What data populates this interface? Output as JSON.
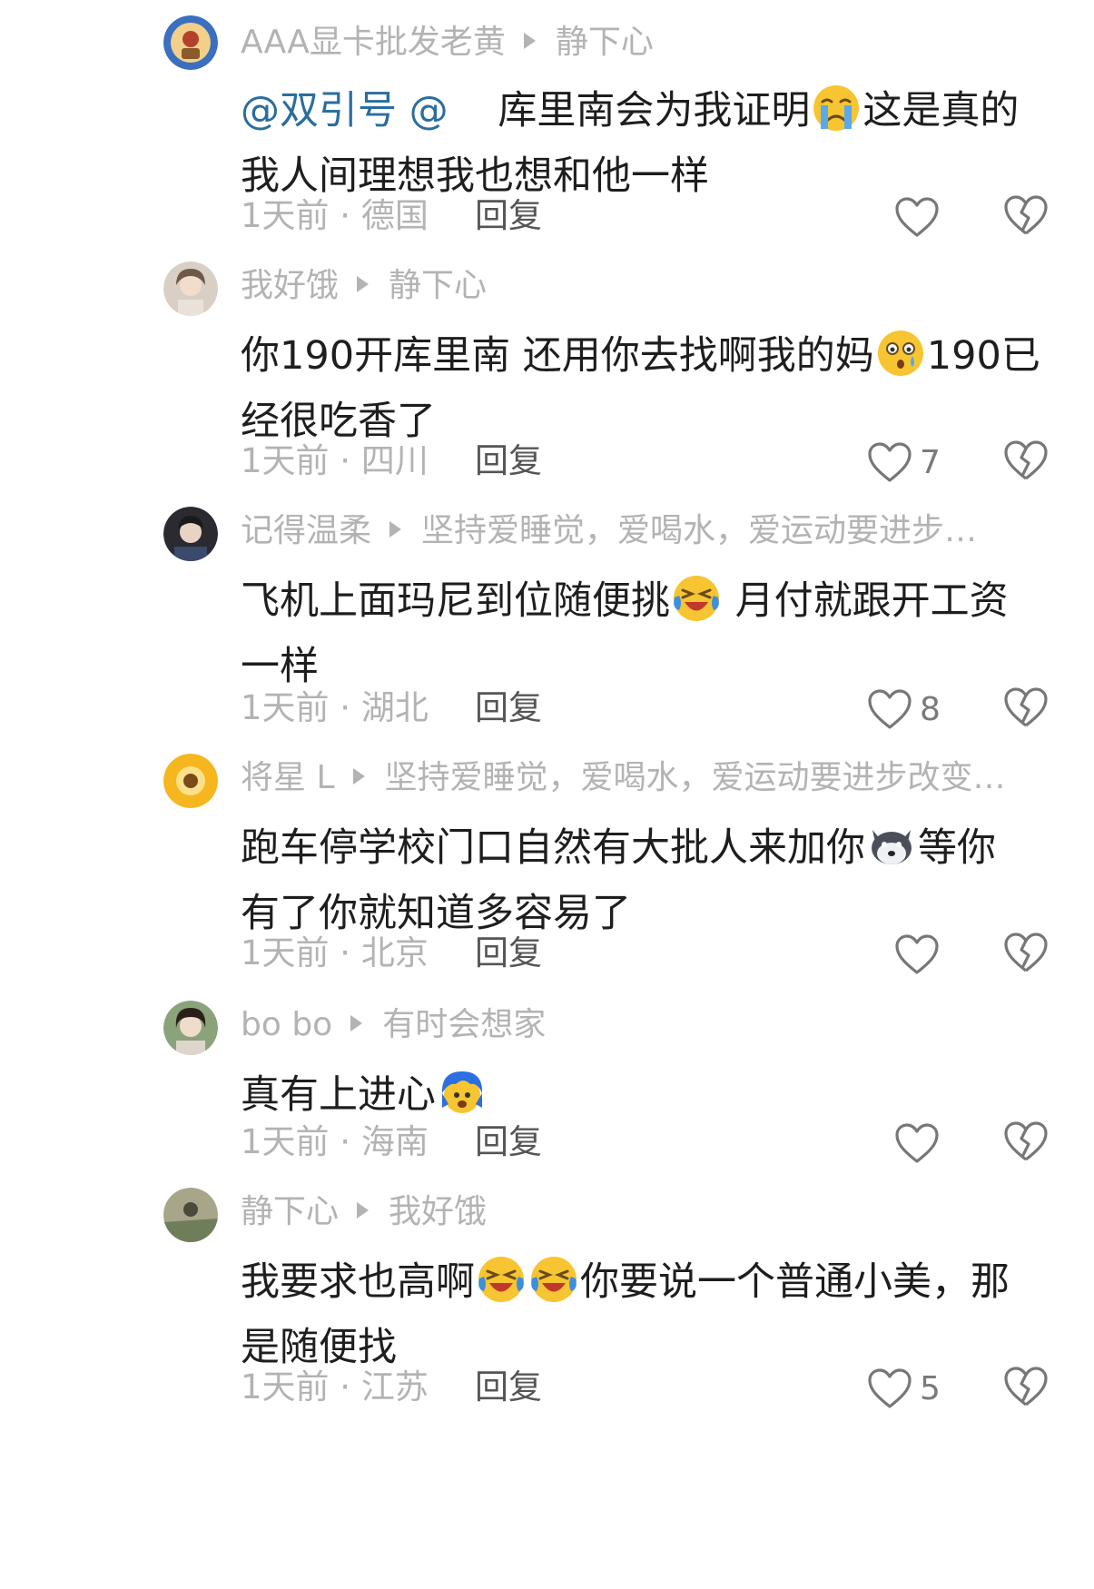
{
  "comments": [
    {
      "username": "AAA显卡批发老黄",
      "reply_to": "静下心",
      "mention1": "@双引号",
      "mention2": "@",
      "text1": "库里南会为我证明",
      "text2": "这是真的",
      "text3": "我人间理想我也想和他一样",
      "emoji": "sad-tear-emoji",
      "time_location": "1天前 · 德国",
      "reply_label": "回复",
      "like_count": ""
    },
    {
      "username": "我好饿",
      "reply_to": "静下心",
      "text1": "你190开库里南 还用你去找啊我的妈",
      "text2": "190已",
      "text3": "经很吃香了",
      "emoji": "shocked-emoji",
      "time_location": "1天前 · 四川",
      "reply_label": "回复",
      "like_count": "7"
    },
    {
      "username": "记得温柔",
      "reply_to": "坚持爱睡觉，爱喝水，爱运动要进步…",
      "text1": "飞机上面玛尼到位随便挑",
      "text2": " 月付就跟开工资",
      "text3": "一样",
      "emoji": "laugh-cry-emoji",
      "time_location": "1天前 · 湖北",
      "reply_label": "回复",
      "like_count": "8"
    },
    {
      "username": "将星 L",
      "reply_to": "坚持爱睡觉，爱喝水，爱运动要进步改变…",
      "text1": "跑车停学校门口自然有大批人来加你",
      "text2": "等你",
      "text3": "有了你就知道多容易了",
      "emoji": "husky-emoji",
      "time_location": "1天前 · 北京",
      "reply_label": "回复",
      "like_count": ""
    },
    {
      "username": "bo bo",
      "reply_to": "有时会想家",
      "text1": "真有上进心",
      "emoji": "blue-hair-emoji",
      "time_location": "1天前 · 海南",
      "reply_label": "回复",
      "like_count": ""
    },
    {
      "username": "静下心",
      "reply_to": "我好饿",
      "text1": "我要求也高啊",
      "text2": "你要说一个普通小美，那",
      "text3": "是随便找",
      "emoji": "laugh-cry-emoji",
      "time_location": "1天前 · 江苏",
      "reply_label": "回复",
      "like_count": "5"
    }
  ],
  "colors": {
    "meta_gray": "#b3b3b3",
    "mention_blue": "#2a6e9e",
    "body_text": "#1e1e1e",
    "icon_gray": "#777777"
  },
  "icons": {
    "like": "heart-outline-icon",
    "dislike": "broken-heart-outline-icon"
  }
}
